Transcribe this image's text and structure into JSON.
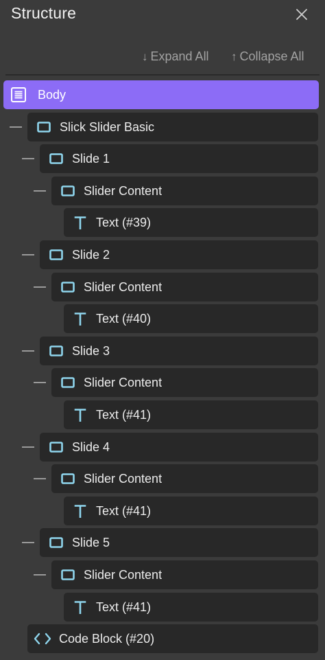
{
  "panel": {
    "title": "Structure",
    "expand_label": "Expand All",
    "collapse_label": "Collapse All",
    "expand_arrow": "↓",
    "collapse_arrow": "↑"
  },
  "colors": {
    "background": "#3b3b3b",
    "node_bg": "#282828",
    "selected": "#8c6cf6",
    "icon_accent": "#8fd6ee"
  },
  "tree": [
    {
      "label": "Body",
      "icon": "body-icon",
      "depth": 0,
      "selected": true,
      "collapsible": false
    },
    {
      "label": "Slick Slider Basic",
      "icon": "box-icon",
      "depth": 1,
      "collapsible": true
    },
    {
      "label": "Slide 1",
      "icon": "box-icon",
      "depth": 2,
      "collapsible": true
    },
    {
      "label": "Slider Content",
      "icon": "box-icon",
      "depth": 3,
      "collapsible": true
    },
    {
      "label": "Text (#39)",
      "icon": "text-icon",
      "depth": 4,
      "collapsible": false
    },
    {
      "label": "Slide 2",
      "icon": "box-icon",
      "depth": 2,
      "collapsible": true
    },
    {
      "label": "Slider Content",
      "icon": "box-icon",
      "depth": 3,
      "collapsible": true
    },
    {
      "label": "Text (#40)",
      "icon": "text-icon",
      "depth": 4,
      "collapsible": false
    },
    {
      "label": "Slide 3",
      "icon": "box-icon",
      "depth": 2,
      "collapsible": true
    },
    {
      "label": "Slider Content",
      "icon": "box-icon",
      "depth": 3,
      "collapsible": true
    },
    {
      "label": "Text (#41)",
      "icon": "text-icon",
      "depth": 4,
      "collapsible": false
    },
    {
      "label": "Slide 4",
      "icon": "box-icon",
      "depth": 2,
      "collapsible": true
    },
    {
      "label": "Slider Content",
      "icon": "box-icon",
      "depth": 3,
      "collapsible": true
    },
    {
      "label": "Text (#41)",
      "icon": "text-icon",
      "depth": 4,
      "collapsible": false
    },
    {
      "label": "Slide 5",
      "icon": "box-icon",
      "depth": 2,
      "collapsible": true
    },
    {
      "label": "Slider Content",
      "icon": "box-icon",
      "depth": 3,
      "collapsible": true
    },
    {
      "label": "Text (#41)",
      "icon": "text-icon",
      "depth": 4,
      "collapsible": false
    },
    {
      "label": "Code Block (#20)",
      "icon": "code-icon",
      "depth": 1,
      "collapsible": false
    }
  ]
}
